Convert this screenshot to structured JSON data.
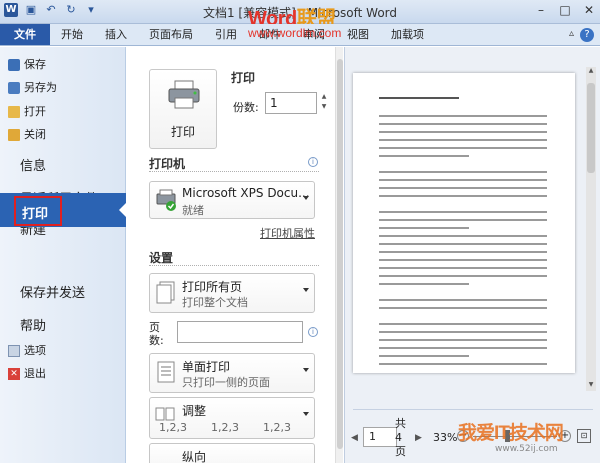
{
  "window": {
    "title": "文档1 [兼容模式] - Microsoft Word",
    "watermark_main": "Word",
    "watermark_accent": "联盟",
    "watermark_url": "www.wordlm.com"
  },
  "ribbon_tabs": [
    "文件",
    "开始",
    "插入",
    "页面布局",
    "引用",
    "邮件",
    "审阅",
    "视图",
    "加载项"
  ],
  "nav": {
    "save": "保存",
    "save_as": "另存为",
    "open": "打开",
    "close": "关闭",
    "info": "信息",
    "recent": "最近所用文件",
    "new": "新建",
    "print": "打印",
    "save_send": "保存并发送",
    "help": "帮助",
    "options": "选项",
    "exit": "退出"
  },
  "print_pane": {
    "header": "打印",
    "print_button": "打印",
    "copies_label": "份数:",
    "copies_value": "1",
    "printer_section": "打印机",
    "printer_name": "Microsoft XPS Docu...",
    "printer_status": "就绪",
    "printer_properties": "打印机属性",
    "settings_section": "设置",
    "range_title": "打印所有页",
    "range_sub": "打印整个文档",
    "pages_label": "页数:",
    "pages_value": "",
    "sides_title": "单面打印",
    "sides_sub": "只打印一侧的页面",
    "collate_title": "调整",
    "collate_seq": [
      "1,2,3",
      "1,2,3",
      "1,2,3"
    ],
    "next_title": "纵向"
  },
  "preview": {
    "page_current": "1",
    "page_total": "共 4 页",
    "zoom": "33%"
  },
  "watermark_bottom": {
    "text": "我爱IT技术网",
    "url": "www.52ij.com"
  },
  "colors": {
    "file_tab": "#2a5aa8",
    "nav_selected": "#2b63b3",
    "highlight_border": "#e02020",
    "watermark_red": "#e3342b",
    "watermark_orange": "#e89a1c"
  }
}
